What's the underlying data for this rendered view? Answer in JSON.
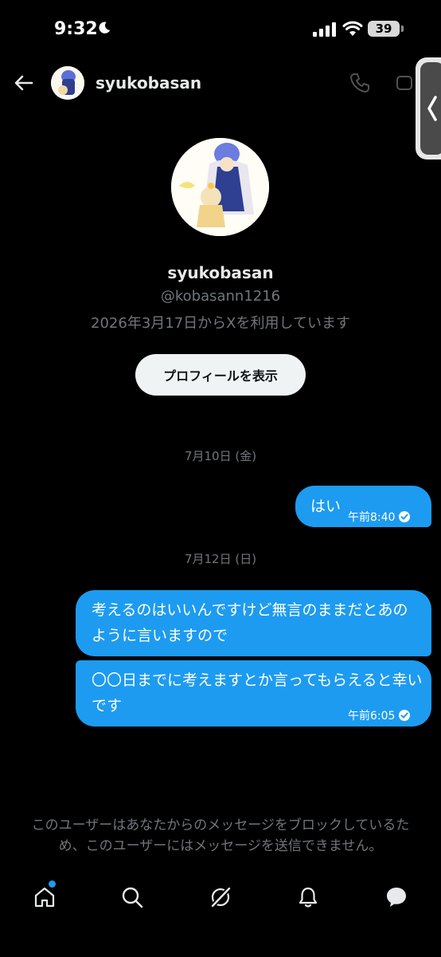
{
  "status_bar": {
    "time": "9:32",
    "battery": "39"
  },
  "header": {
    "name": "syukobasan"
  },
  "profile": {
    "name": "syukobasan",
    "handle": "@kobasann1216",
    "joined": "2026年3月17日からXを利用しています",
    "button_label": "プロフィールを表示"
  },
  "conversation": {
    "dates": [
      "7月10日 (金)",
      "7月12日 (日)"
    ],
    "messages": [
      {
        "text": "はい",
        "time": "午前8:40"
      },
      {
        "text": "考えるのはいいんですけど無言のままだとあのように言いますので"
      },
      {
        "text": "〇〇日までに考えますとか言ってもらえると幸いです",
        "time": "午前6:05"
      }
    ]
  },
  "blocked_notice": "このユーザーはあなたからのメッセージをブロックしているため、このユーザーにはメッセージを送信できません。",
  "bottom_nav": [
    "home-icon",
    "search-icon",
    "grok-icon",
    "notifications-icon",
    "messages-icon"
  ],
  "colors": {
    "accent": "#1d9bf0",
    "background": "#000000",
    "secondary_text": "#71767b"
  }
}
